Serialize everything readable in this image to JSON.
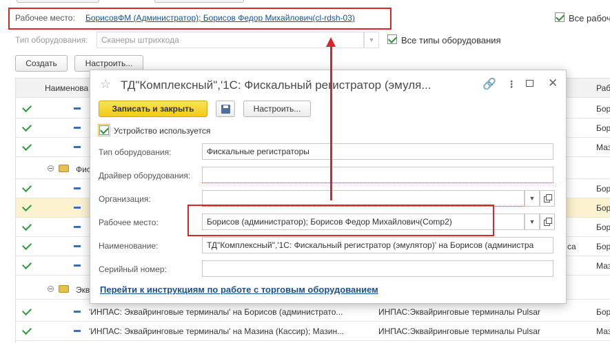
{
  "header": {
    "workplace_label": "Рабочее место:",
    "workplace_value": "БорисовФМ (Администратор); Борисов Федор Михайлович(cl-rdsh-03)",
    "all_workplaces_label": "Все рабоч",
    "equipment_type_label": "Тип оборудования:",
    "equipment_type_value": "Сканеры штрихкода",
    "all_types_label": "Все типы оборудования"
  },
  "toolbar": {
    "create_label": "Создать",
    "configure_label": "Настроить..."
  },
  "grid": {
    "col_name": "Наименова",
    "col_workplace": "Раб",
    "rows": [
      {
        "t3": "Бор"
      },
      {
        "t3": "Бор"
      },
      {
        "t3": "Маз"
      },
      {
        "group": "Фис"
      },
      {
        "t3": "Бор"
      },
      {
        "t3": "Бор"
      },
      {
        "t3": "Бор"
      },
      {
        "t2": "са",
        "t3": "Бор"
      },
      {
        "t3": "Маз"
      },
      {
        "group": "Экв"
      },
      {
        "t1": "'ИНПАС: Эквайринговые терминалы' на Борисов (администрато...",
        "t2": "ИНПАС:Эквайринговые терминалы Pulsar",
        "t3": "Бор"
      },
      {
        "t1": "'ИНПАС: Эквайринговые терминалы' на Мазина (Кассир); Мазин...",
        "t2": "ИНПАС:Эквайринговые терминалы Pulsar",
        "t3": "Маз"
      }
    ]
  },
  "dialog": {
    "title": "ТД\"Комплексный\",'1С: Фискальный регистратор (эмуля...",
    "save_close_label": "Записать и закрыть",
    "configure_label": "Настроить...",
    "device_used_label": "Устройство используется",
    "fields": {
      "equipment_type_label": "Тип оборудования:",
      "equipment_type_value": "Фискальные регистраторы",
      "driver_label": "Драйвер оборудования:",
      "driver_value": "",
      "organization_label": "Организация:",
      "organization_value": "",
      "workplace_label": "Рабочее место:",
      "workplace_value": "Борисов (администратор); Борисов Федор Михайлович(Comp2)",
      "name_label": "Наименование:",
      "name_value": "ТД\"Комплексный\",'1С: Фискальный регистратор (эмулятор)' на Борисов (администра",
      "serial_label": "Серийный номер:",
      "serial_value": ""
    },
    "instructions_link": "Перейти к инструкциям по работе с торговым оборудованием"
  },
  "colors": {
    "annotation_red": "#d8252b",
    "save_button_yellow": "#f5d327",
    "link_blue": "#1d4f8f",
    "check_green": "#2e9b42"
  }
}
